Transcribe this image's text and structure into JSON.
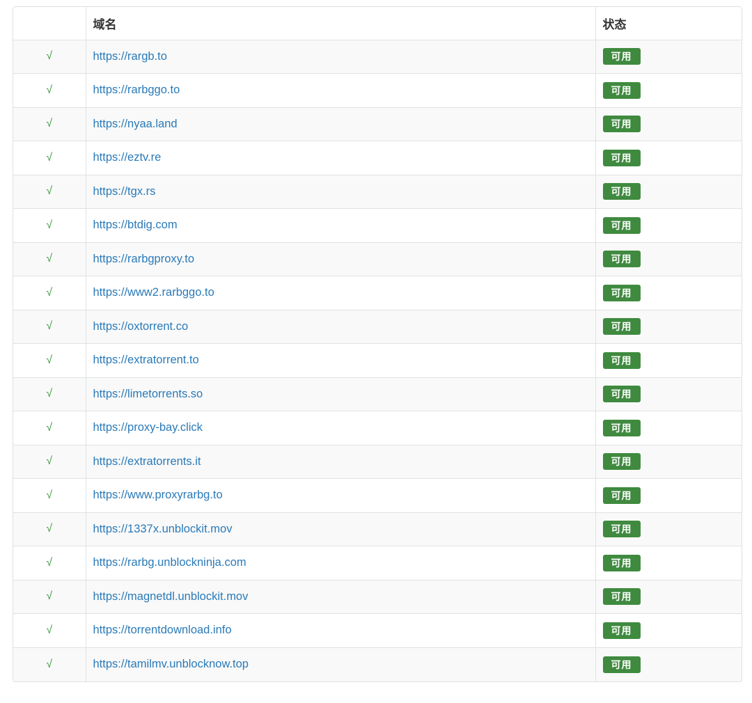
{
  "table": {
    "headers": [
      "",
      "域名",
      "状态"
    ],
    "rows": [
      {
        "mark": "√",
        "domain": "https://rargb.to",
        "status": "可用"
      },
      {
        "mark": "√",
        "domain": "https://rarbggo.to",
        "status": "可用"
      },
      {
        "mark": "√",
        "domain": "https://nyaa.land",
        "status": "可用"
      },
      {
        "mark": "√",
        "domain": "https://eztv.re",
        "status": "可用"
      },
      {
        "mark": "√",
        "domain": "https://tgx.rs",
        "status": "可用"
      },
      {
        "mark": "√",
        "domain": "https://btdig.com",
        "status": "可用"
      },
      {
        "mark": "√",
        "domain": "https://rarbgproxy.to",
        "status": "可用"
      },
      {
        "mark": "√",
        "domain": "https://www2.rarbggo.to",
        "status": "可用"
      },
      {
        "mark": "√",
        "domain": "https://oxtorrent.co",
        "status": "可用"
      },
      {
        "mark": "√",
        "domain": "https://extratorrent.to",
        "status": "可用"
      },
      {
        "mark": "√",
        "domain": "https://limetorrents.so",
        "status": "可用"
      },
      {
        "mark": "√",
        "domain": "https://proxy-bay.click",
        "status": "可用"
      },
      {
        "mark": "√",
        "domain": "https://extratorrents.it",
        "status": "可用"
      },
      {
        "mark": "√",
        "domain": "https://www.proxyrarbg.to",
        "status": "可用"
      },
      {
        "mark": "√",
        "domain": "https://1337x.unblockit.mov",
        "status": "可用"
      },
      {
        "mark": "√",
        "domain": "https://rarbg.unblockninja.com",
        "status": "可用"
      },
      {
        "mark": "√",
        "domain": "https://magnetdl.unblockit.mov",
        "status": "可用"
      },
      {
        "mark": "√",
        "domain": "https://torrentdownload.info",
        "status": "可用"
      },
      {
        "mark": "√",
        "domain": "https://tamilmv.unblocknow.top",
        "status": "可用"
      }
    ]
  },
  "colors": {
    "check": "#3c9b3c",
    "link": "#2a7ab8",
    "badge_bg": "#3f8a3f",
    "stripe": "#f9f9f9"
  }
}
